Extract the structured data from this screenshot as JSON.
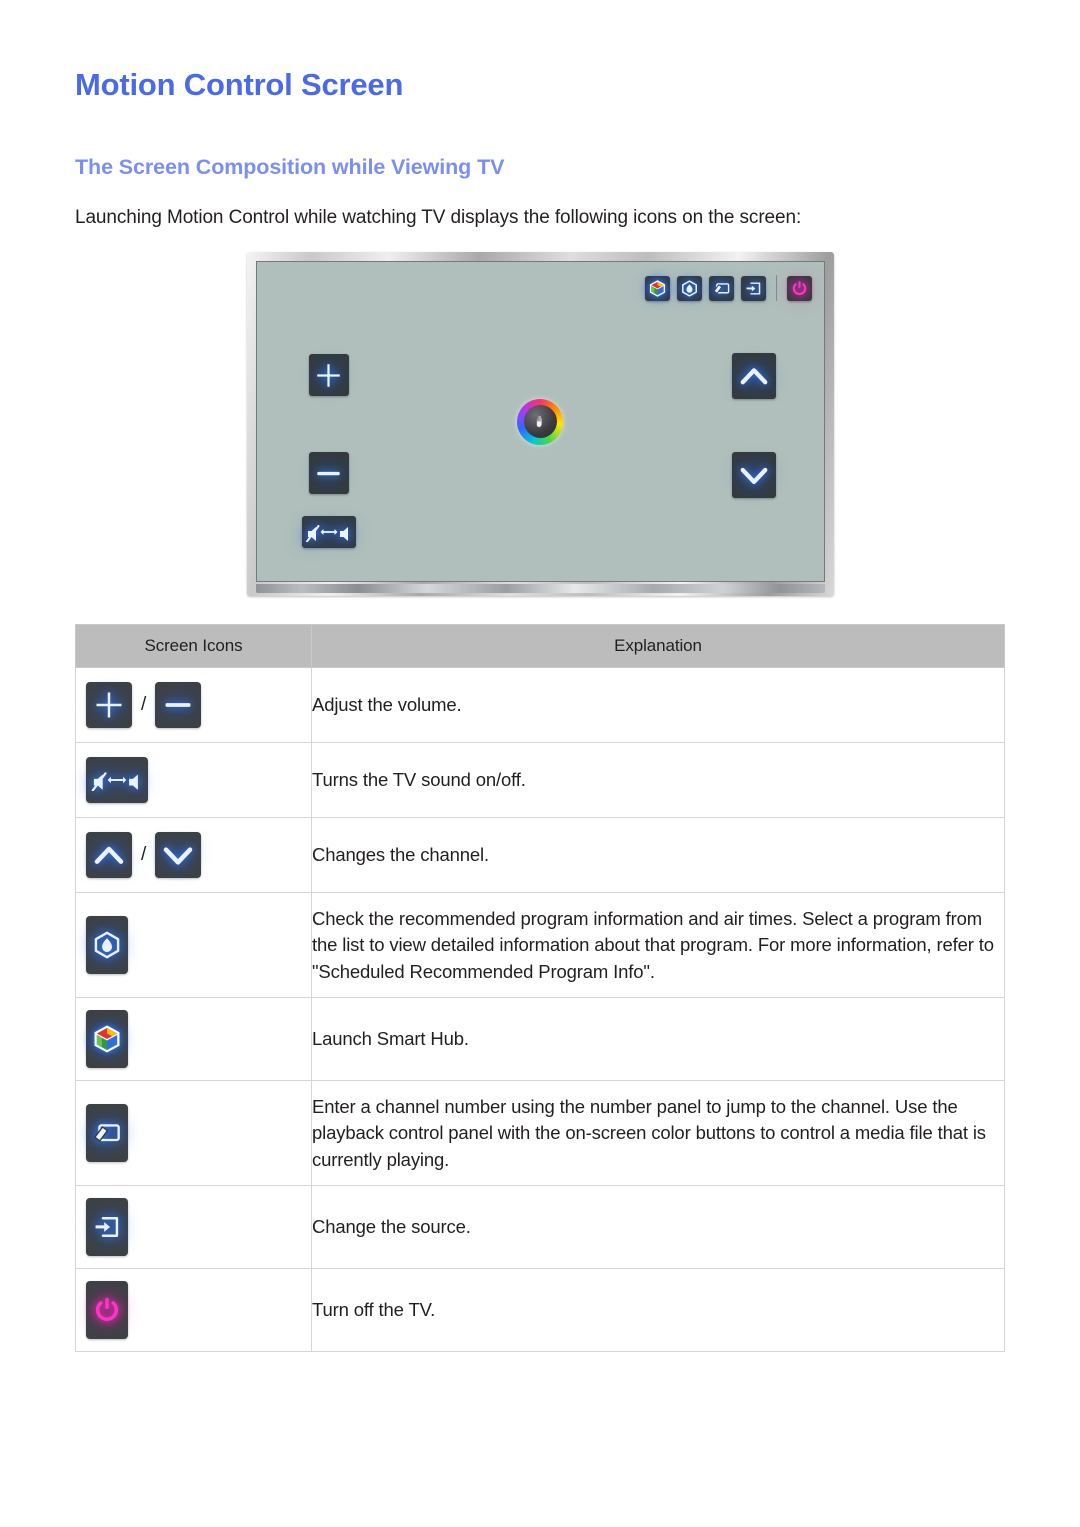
{
  "document": {
    "title": "Motion Control Screen",
    "section_title": "The Screen Composition while Viewing TV",
    "intro": "Launching Motion Control while watching TV displays the following icons on the screen:"
  },
  "colors": {
    "title_blue": "#4a6ae8",
    "section_blue": "#7b8ff0",
    "screen_bg": "#b0bfbb",
    "button_dark": "#343a3e",
    "glow_blue": "#2f7bff",
    "power_pink": "#ff2ec4",
    "table_header_gray": "#bcbcbc",
    "table_border": "#d6d6d6",
    "body_text": "#231f20"
  },
  "tv_illustration": {
    "label": "Motion Control on-screen display mockup",
    "top_bar_icons": [
      {
        "name": "smart-hub-icon",
        "title": "Smart Hub"
      },
      {
        "name": "recommendations-icon",
        "title": "Recommended programs"
      },
      {
        "name": "playback-control-icon",
        "title": "Number / playback panel"
      },
      {
        "name": "source-icon",
        "title": "Change the source"
      },
      {
        "name": "power-icon",
        "title": "Turn off the TV"
      }
    ],
    "left_icons": [
      {
        "name": "volume-up-icon",
        "title": "Volume up"
      },
      {
        "name": "volume-down-icon",
        "title": "Volume down"
      },
      {
        "name": "mute-toggle-icon",
        "title": "Mute on/off"
      }
    ],
    "right_icons": [
      {
        "name": "channel-up-icon",
        "title": "Channel up"
      },
      {
        "name": "channel-down-icon",
        "title": "Channel down"
      }
    ],
    "center_pointer": {
      "name": "hand-pointer-icon",
      "title": "Motion control hand pointer"
    }
  },
  "table": {
    "headers": {
      "icons": "Screen Icons",
      "explanation": "Explanation"
    },
    "rows": [
      {
        "icons": [
          "volume-up-icon",
          "volume-down-icon"
        ],
        "separator": "/",
        "explanation": "Adjust the volume."
      },
      {
        "icons": [
          "mute-toggle-icon"
        ],
        "separator": "",
        "explanation": "Turns the TV sound on/off."
      },
      {
        "icons": [
          "channel-up-icon",
          "channel-down-icon"
        ],
        "separator": "/",
        "explanation": "Changes the channel."
      },
      {
        "icons": [
          "recommendations-icon"
        ],
        "separator": "",
        "explanation": "Check the recommended program information and air times. Select a program from the list to view detailed information about that program. For more information, refer to \"Scheduled Recommended Program Info\"."
      },
      {
        "icons": [
          "smart-hub-icon"
        ],
        "separator": "",
        "explanation": "Launch Smart Hub."
      },
      {
        "icons": [
          "playback-control-icon"
        ],
        "separator": "",
        "explanation": "Enter a channel number using the number panel to jump to the channel. Use the playback control panel with the on-screen color buttons to control a media file that is currently playing."
      },
      {
        "icons": [
          "source-icon"
        ],
        "separator": "",
        "explanation": "Change the source."
      },
      {
        "icons": [
          "power-icon"
        ],
        "separator": "",
        "explanation": "Turn off the TV."
      }
    ]
  }
}
